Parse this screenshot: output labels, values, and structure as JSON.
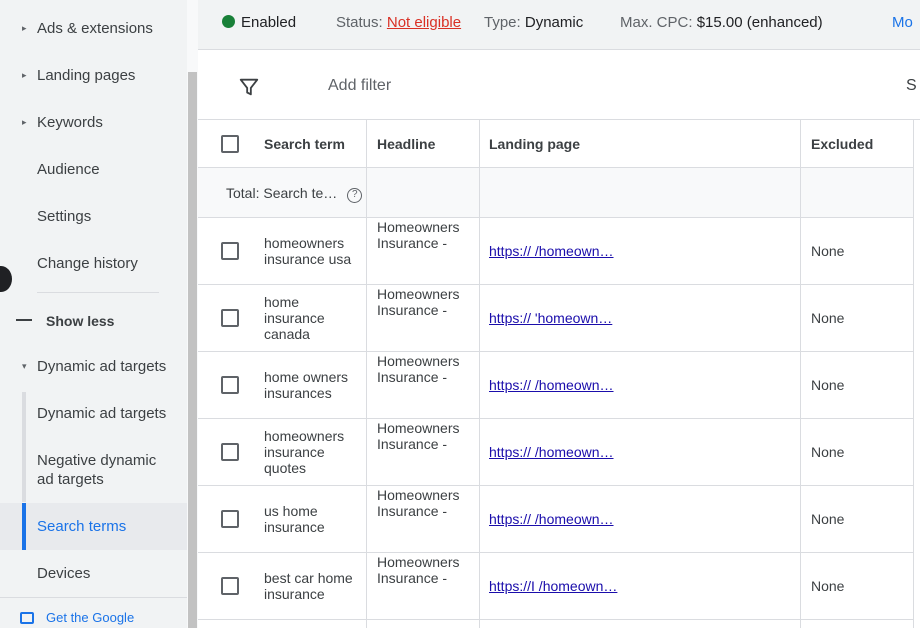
{
  "sidebar": {
    "items": [
      {
        "label": "Ads & extensions",
        "caret": "▸"
      },
      {
        "label": "Landing pages",
        "caret": "▸"
      },
      {
        "label": "Keywords",
        "caret": "▸"
      },
      {
        "label": "Audience"
      },
      {
        "label": "Settings"
      },
      {
        "label": "Change history"
      }
    ],
    "show_less": "Show less",
    "section": {
      "label": "Dynamic ad targets",
      "caret": "▾"
    },
    "sub_items": [
      {
        "label": "Dynamic ad targets"
      },
      {
        "label": "Negative dynamic ad targets"
      },
      {
        "label": "Search terms",
        "selected": true
      },
      {
        "label": "Devices"
      }
    ],
    "footer_link": "Get the Google"
  },
  "status": {
    "state": "Enabled",
    "status_label": "Status:",
    "status_value": "Not eligible",
    "type_label": "Type:",
    "type_value": "Dynamic",
    "cpc_label": "Max. CPC:",
    "cpc_value": "$15.00 (enhanced)",
    "more": "Mo",
    "colors": {
      "enabled": "#188038",
      "not_eligible": "#d93025",
      "link": "#1a73e8"
    }
  },
  "filter": {
    "icon": "filter-icon",
    "placeholder": "Add filter",
    "right_cut": "S"
  },
  "table": {
    "headers": {
      "term": "Search term",
      "headline": "Headline",
      "landing": "Landing page",
      "excluded": "Excluded"
    },
    "total_label": "Total: Search te…",
    "rows": [
      {
        "term": "homeowners insurance usa",
        "headline": "Homeowners Insurance -",
        "landing": "https://                                          /homeown…",
        "excluded": "None"
      },
      {
        "term": "home insurance canada",
        "headline": "Homeowners Insurance -",
        "landing": "https://                                          'homeown…",
        "excluded": "None"
      },
      {
        "term": "home owners insurances",
        "headline": "Homeowners Insurance -",
        "landing": "https://                                          /homeown…",
        "excluded": "None"
      },
      {
        "term": "homeowners insurance quotes",
        "headline": "Homeowners Insurance -",
        "landing": "https://                                          /homeown…",
        "excluded": "None"
      },
      {
        "term": "us home insurance",
        "headline": "Homeowners Insurance -",
        "landing": "https://                                          /homeown…",
        "excluded": "None"
      },
      {
        "term": "best car home insurance",
        "headline": "Homeowners Insurance -",
        "landing": "https://I                                         /homeown…",
        "excluded": "None"
      }
    ]
  }
}
